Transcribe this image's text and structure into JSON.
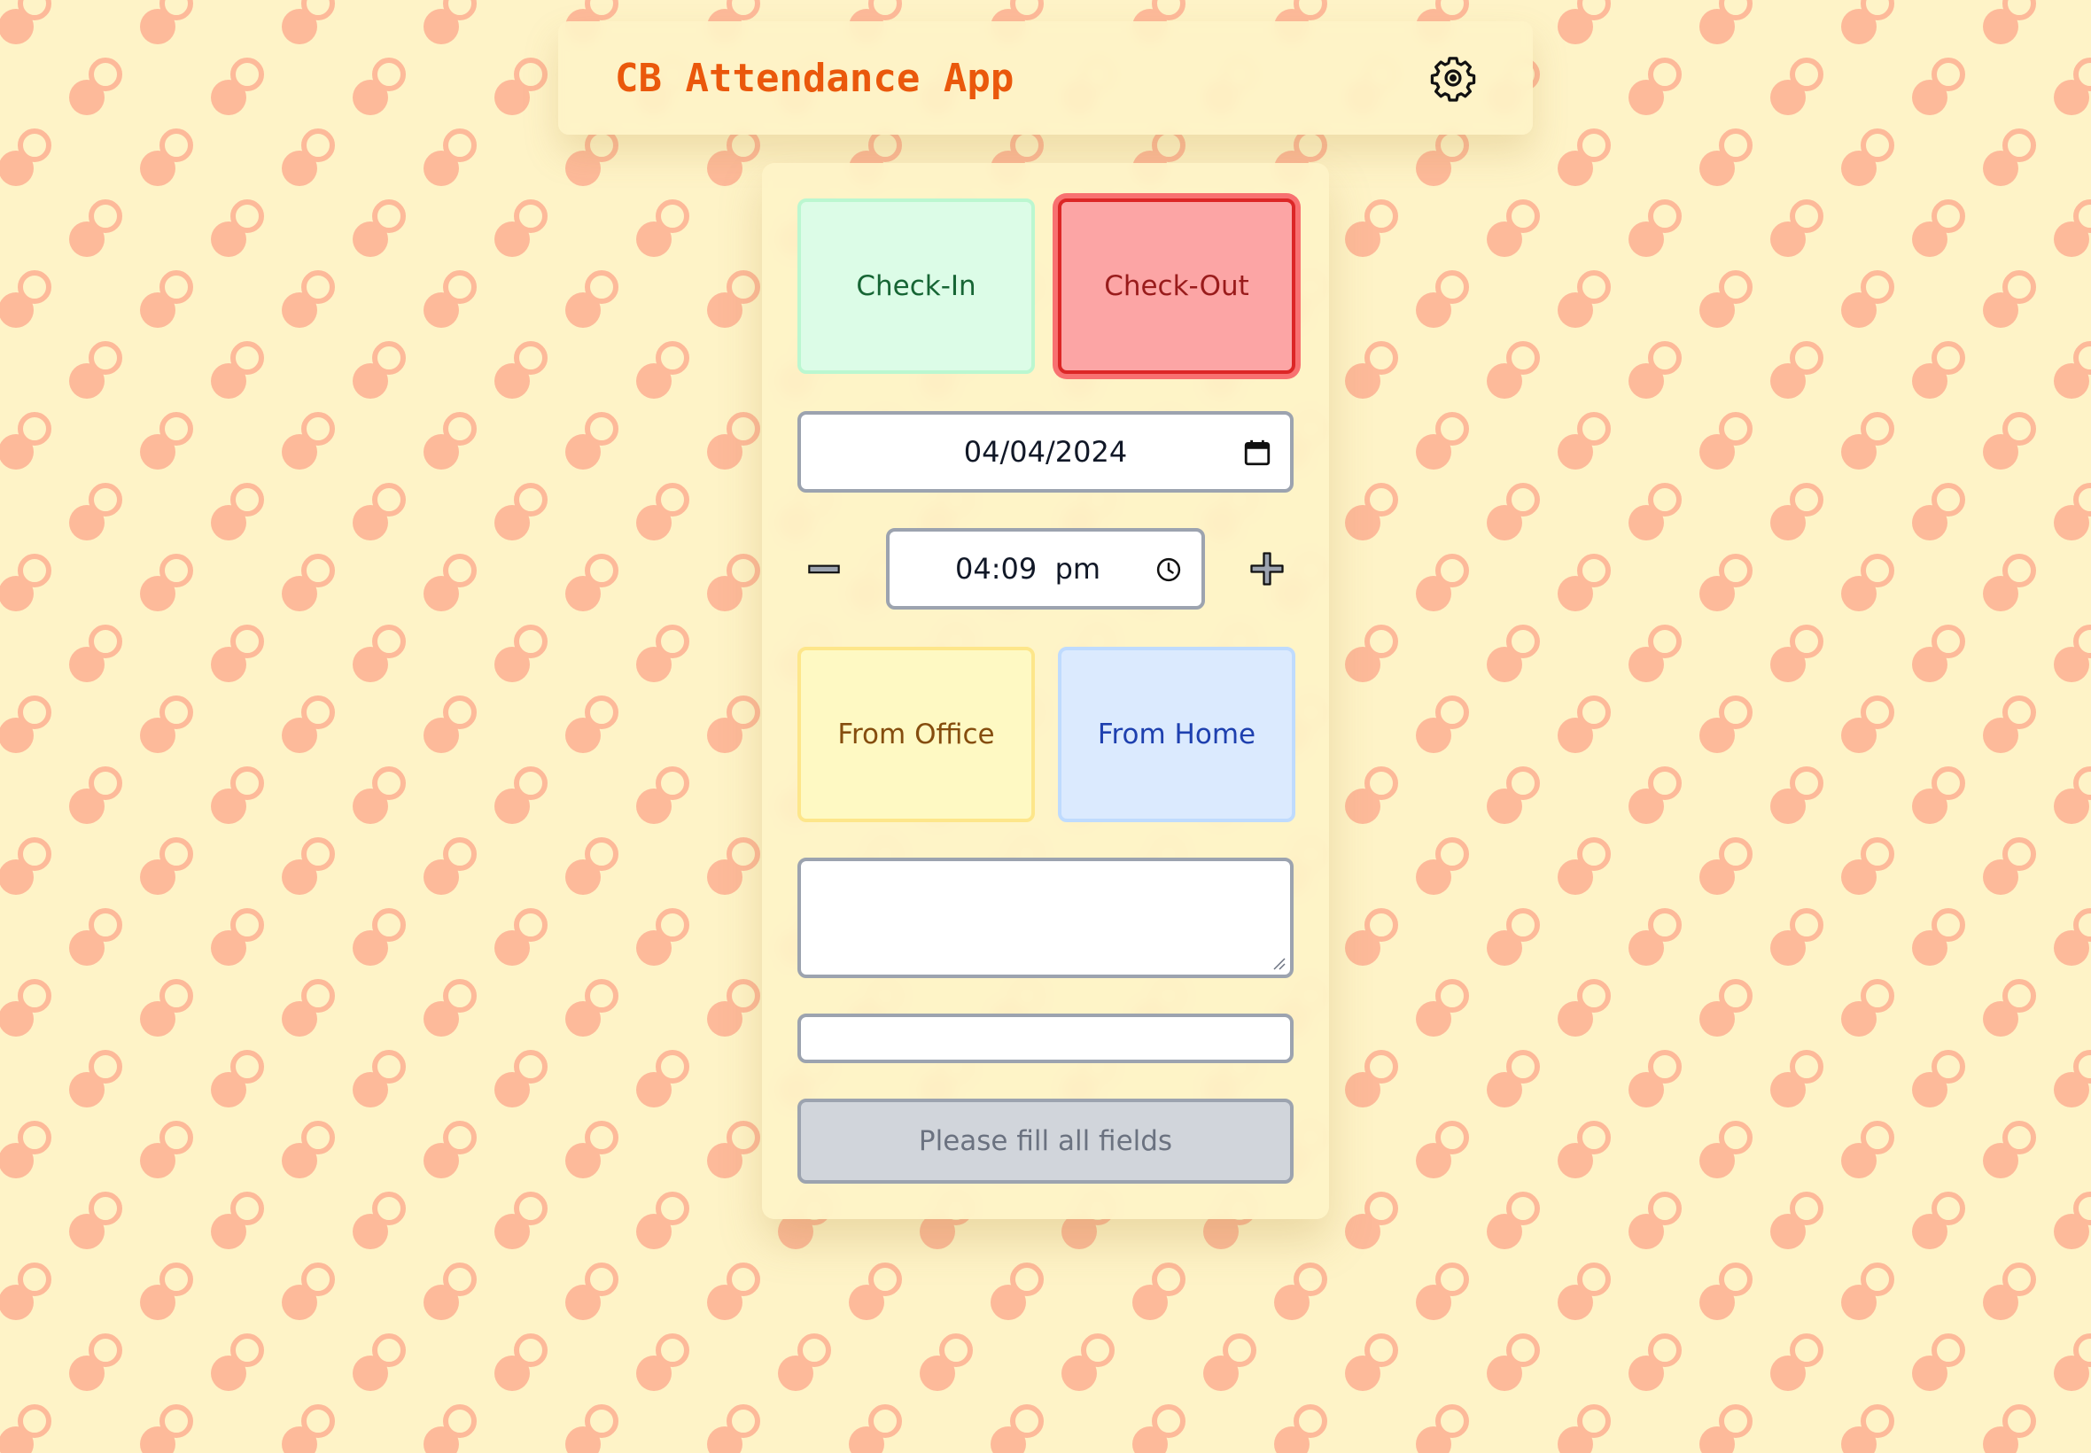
{
  "header": {
    "title": "CB Attendance App",
    "settings_icon": "gear-icon"
  },
  "attendance": {
    "check_in_label": "Check-In",
    "check_out_label": "Check-Out",
    "selected_action": "Check-Out",
    "date_value": "04/04/2024",
    "time_value": "04:09  pm",
    "location_office_label": "From Office",
    "location_home_label": "From Home",
    "notes_value": "",
    "extra_value": "",
    "submit_label": "Please fill all fields"
  },
  "colors": {
    "accent": "#ea580c",
    "background": "#fef3c7",
    "pattern": "#fdba9a",
    "check_in": "#dcfce7",
    "check_out": "#fca5a5",
    "office": "#fef9c3",
    "home": "#dbeafe",
    "disabled": "#d1d5db"
  }
}
